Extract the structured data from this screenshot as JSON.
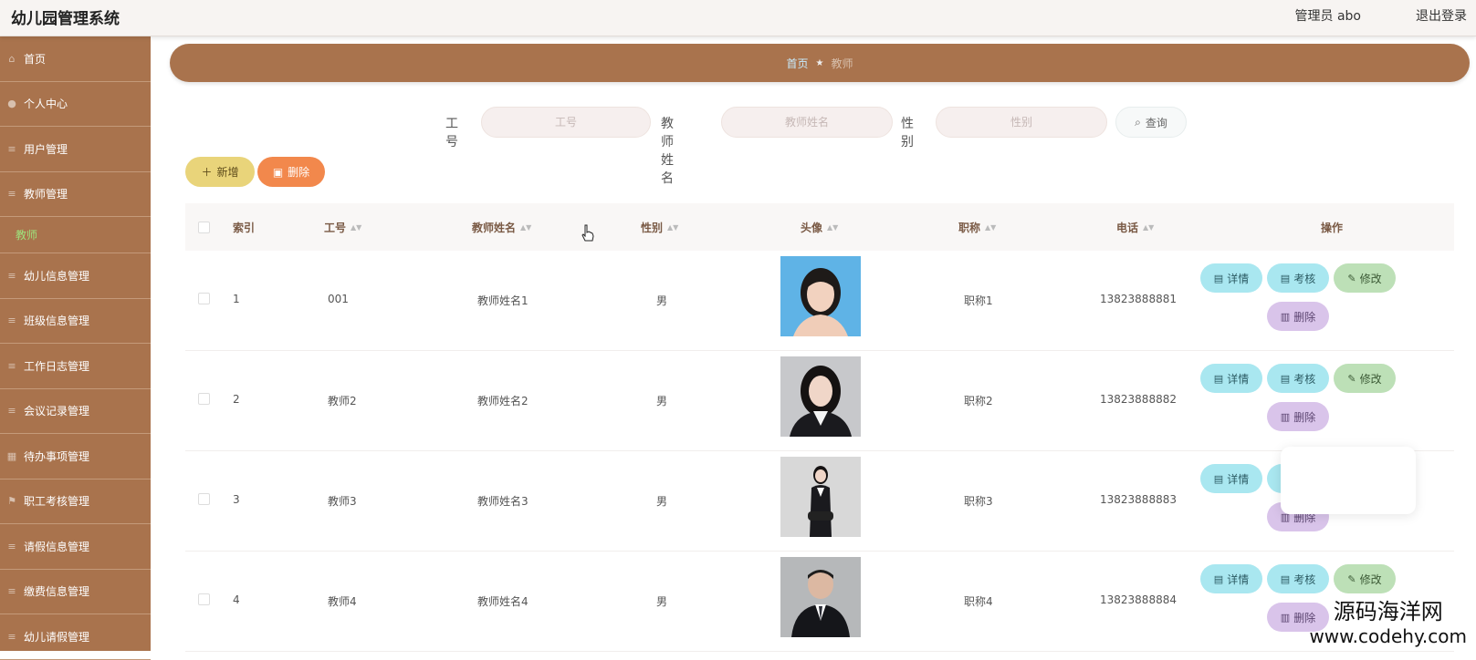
{
  "header": {
    "title": "幼儿园管理系统",
    "user_label": "管理员 abo",
    "logout_label": "退出登录"
  },
  "sidebar": {
    "items": [
      {
        "label": "首页",
        "icon": "home-icon"
      },
      {
        "label": "个人中心",
        "icon": "user-icon"
      },
      {
        "label": "用户管理",
        "icon": "list-icon"
      },
      {
        "label": "教师管理",
        "icon": "list-icon"
      },
      {
        "label": "幼儿信息管理",
        "icon": "list-icon"
      },
      {
        "label": "班级信息管理",
        "icon": "list-icon"
      },
      {
        "label": "工作日志管理",
        "icon": "list-icon"
      },
      {
        "label": "会议记录管理",
        "icon": "list-icon"
      },
      {
        "label": "待办事项管理",
        "icon": "grid-icon"
      },
      {
        "label": "职工考核管理",
        "icon": "flag-icon"
      },
      {
        "label": "请假信息管理",
        "icon": "list-icon"
      },
      {
        "label": "缴费信息管理",
        "icon": "list-icon"
      },
      {
        "label": "幼儿请假管理",
        "icon": "list-icon"
      }
    ],
    "active_sub": "教师"
  },
  "breadcrumb": {
    "home": "首页",
    "current": "教师"
  },
  "search": {
    "fields": [
      {
        "label": "工号",
        "placeholder": "工号"
      },
      {
        "label": "教师姓名",
        "placeholder": "教师姓名"
      },
      {
        "label": "性别",
        "placeholder": "性别"
      }
    ],
    "query_label": "查询"
  },
  "actions": {
    "add_label": "新增",
    "delete_label": "删除"
  },
  "table": {
    "columns": [
      "索引",
      "工号",
      "教师姓名",
      "性别",
      "头像",
      "职称",
      "电话",
      "操作"
    ],
    "rows": [
      {
        "index": "1",
        "id": "001",
        "name": "教师姓名1",
        "gender": "男",
        "title": "职称1",
        "phone": "13823888881"
      },
      {
        "index": "2",
        "id": "教师2",
        "name": "教师姓名2",
        "gender": "男",
        "title": "职称2",
        "phone": "13823888882"
      },
      {
        "index": "3",
        "id": "教师3",
        "name": "教师姓名3",
        "gender": "男",
        "title": "职称3",
        "phone": "13823888883"
      },
      {
        "index": "4",
        "id": "教师4",
        "name": "教师姓名4",
        "gender": "男",
        "title": "职称4",
        "phone": "13823888884"
      }
    ],
    "row_actions": {
      "detail": "详情",
      "check": "考核",
      "edit": "修改",
      "delete": "删除"
    }
  },
  "watermark": {
    "line1": "源码海洋网",
    "line2": "www.codehy.com"
  },
  "colors": {
    "sidebar": "#a9734d",
    "accent": "#a9734d",
    "active_sub": "#9ee37d"
  }
}
